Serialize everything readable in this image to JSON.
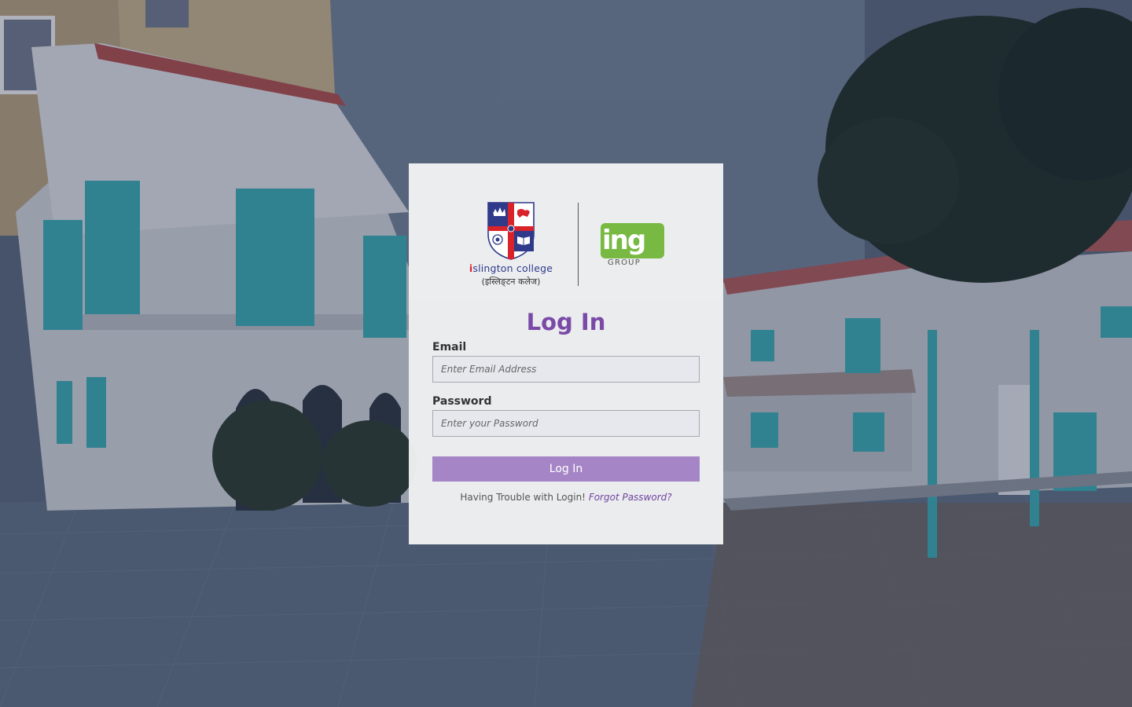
{
  "college": {
    "logo_initial": "i",
    "name_rest": "slington college",
    "name_devanagari": "(इस्लिङ्टन कलेज)"
  },
  "partner": {
    "logo_text": "ing",
    "logo_sub": "GROUP"
  },
  "login": {
    "title": "Log In",
    "email_label": "Email",
    "email_placeholder": "Enter Email Address",
    "email_value": "",
    "password_label": "Password",
    "password_placeholder": "Enter your Password",
    "password_value": "",
    "submit_label": "Log In",
    "trouble_text": "Having Trouble with Login!",
    "forgot_link": "Forgot Password?"
  },
  "colors": {
    "accent": "#7a4aa8",
    "button": "#a585c6",
    "college_red": "#d8232a",
    "college_blue": "#2f3a8a",
    "partner_green": "#78b943"
  },
  "icons": {
    "college_crest": "crest-shield-icon",
    "partner_logo": "ing-group-logo"
  }
}
